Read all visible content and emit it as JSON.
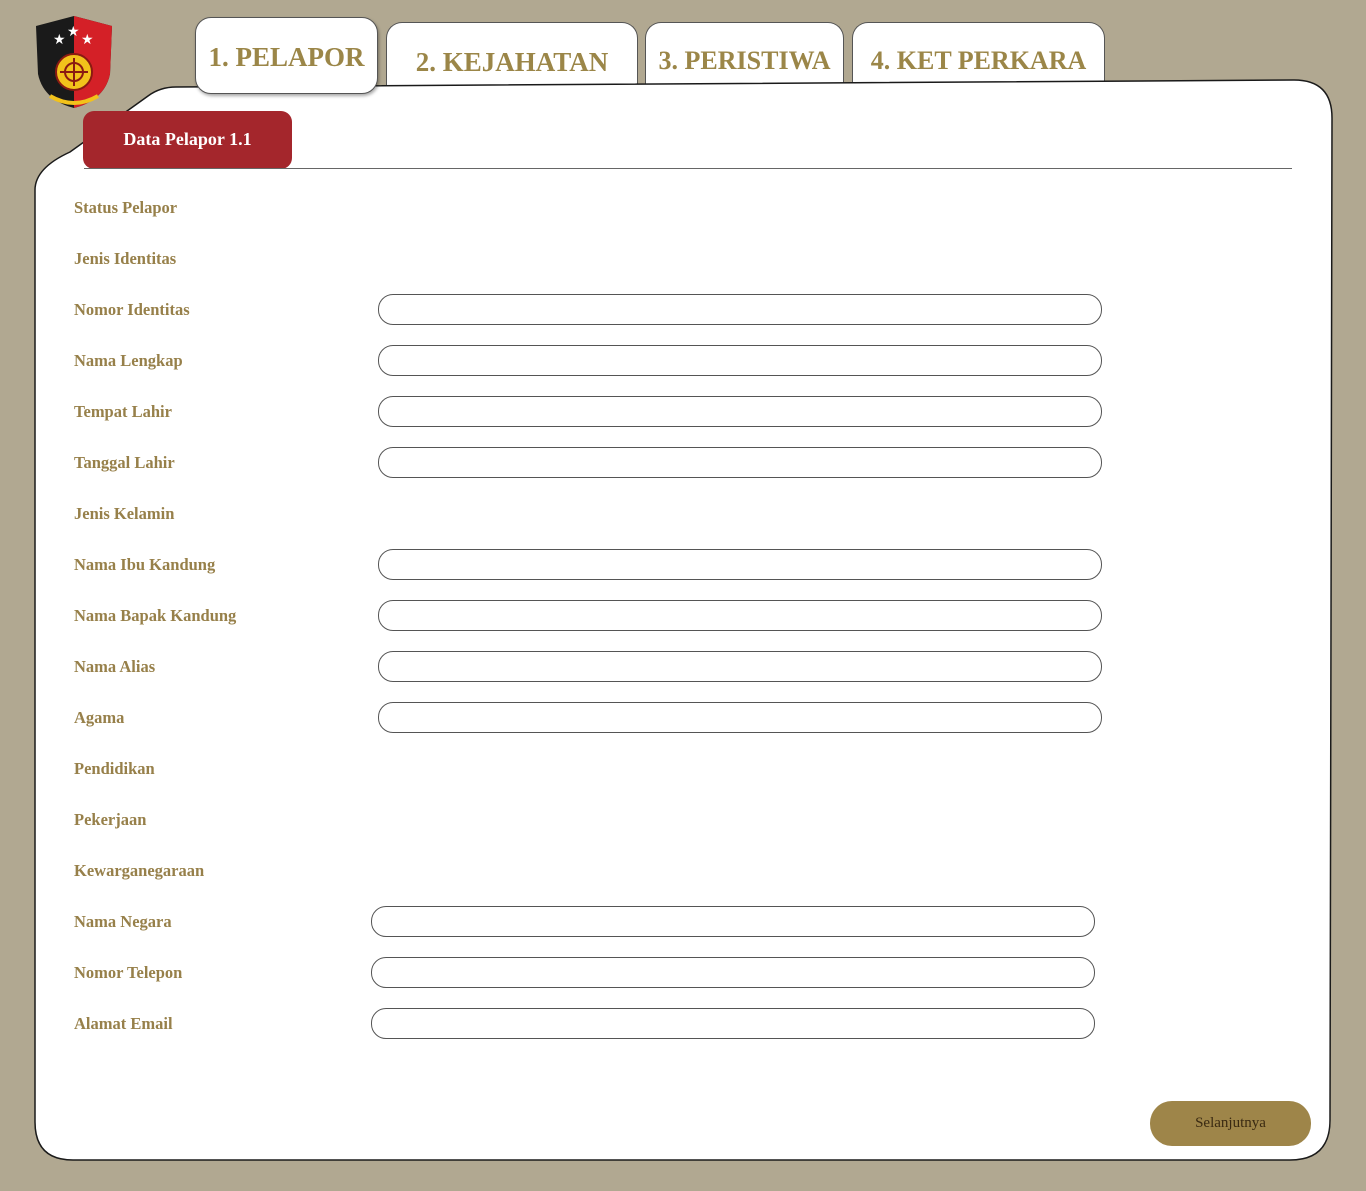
{
  "tabs": [
    {
      "label": "1. PELAPOR",
      "active": true
    },
    {
      "label": "2. KEJAHATAN",
      "active": false
    },
    {
      "label": "3. PERISTIWA",
      "active": false
    },
    {
      "label": "4. KET PERKARA",
      "active": false
    }
  ],
  "section": {
    "title": "Data Pelapor 1.1"
  },
  "form": {
    "status_pelapor": {
      "label": "Status Pelapor"
    },
    "jenis_identitas": {
      "label": "Jenis Identitas"
    },
    "nomor_identitas": {
      "label": "Nomor Identitas",
      "value": ""
    },
    "nama_lengkap": {
      "label": "Nama Lengkap",
      "value": ""
    },
    "tempat_lahir": {
      "label": "Tempat Lahir",
      "value": ""
    },
    "tanggal_lahir": {
      "label": "Tanggal Lahir",
      "value": ""
    },
    "jenis_kelamin": {
      "label": "Jenis Kelamin"
    },
    "nama_ibu_kandung": {
      "label": "Nama Ibu Kandung",
      "value": ""
    },
    "nama_bapak_kandung": {
      "label": "Nama Bapak Kandung",
      "value": ""
    },
    "nama_alias": {
      "label": "Nama Alias",
      "value": ""
    },
    "agama": {
      "label": "Agama",
      "value": ""
    },
    "pendidikan": {
      "label": "Pendidikan"
    },
    "pekerjaan": {
      "label": "Pekerjaan"
    },
    "kewarganegaraan": {
      "label": "Kewarganegaraan"
    },
    "nama_negara": {
      "label": "Nama Negara",
      "value": ""
    },
    "nomor_telepon": {
      "label": "Nomor Telepon",
      "value": ""
    },
    "alamat_email": {
      "label": "Alamat Email",
      "value": ""
    }
  },
  "buttons": {
    "next": "Selanjutnya"
  },
  "logo": {
    "icon": "police-crest-icon",
    "colors": {
      "red": "#d42027",
      "black": "#1a1a1a",
      "gold": "#f2c21b"
    }
  },
  "colors": {
    "background": "#b1a891",
    "label": "#97804a",
    "tab_text": "#9b8648",
    "section_header": "#a4262c",
    "next_button": "#9e8549"
  }
}
